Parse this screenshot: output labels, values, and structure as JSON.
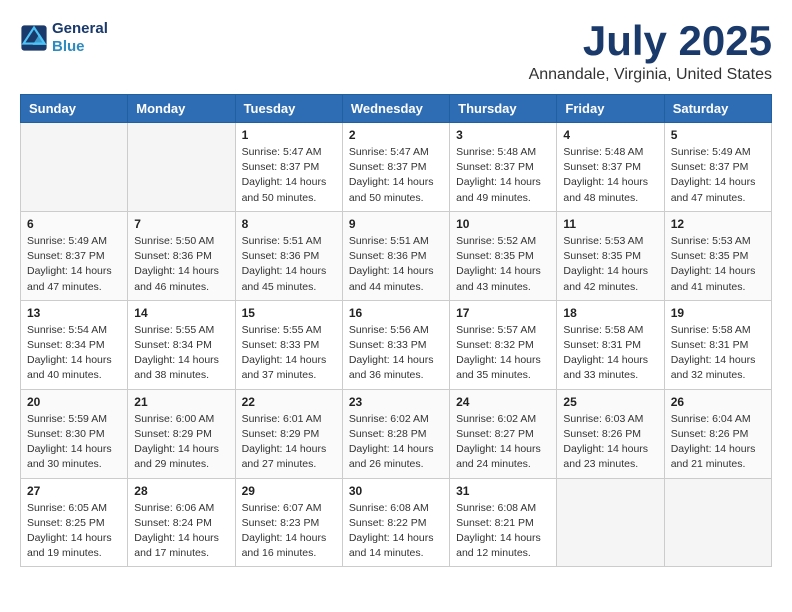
{
  "header": {
    "logo_line1": "General",
    "logo_line2": "Blue",
    "title": "July 2025",
    "subtitle": "Annandale, Virginia, United States"
  },
  "days_of_week": [
    "Sunday",
    "Monday",
    "Tuesday",
    "Wednesday",
    "Thursday",
    "Friday",
    "Saturday"
  ],
  "weeks": [
    [
      {
        "day": "",
        "info": ""
      },
      {
        "day": "",
        "info": ""
      },
      {
        "day": "1",
        "info": "Sunrise: 5:47 AM\nSunset: 8:37 PM\nDaylight: 14 hours and 50 minutes."
      },
      {
        "day": "2",
        "info": "Sunrise: 5:47 AM\nSunset: 8:37 PM\nDaylight: 14 hours and 50 minutes."
      },
      {
        "day": "3",
        "info": "Sunrise: 5:48 AM\nSunset: 8:37 PM\nDaylight: 14 hours and 49 minutes."
      },
      {
        "day": "4",
        "info": "Sunrise: 5:48 AM\nSunset: 8:37 PM\nDaylight: 14 hours and 48 minutes."
      },
      {
        "day": "5",
        "info": "Sunrise: 5:49 AM\nSunset: 8:37 PM\nDaylight: 14 hours and 47 minutes."
      }
    ],
    [
      {
        "day": "6",
        "info": "Sunrise: 5:49 AM\nSunset: 8:37 PM\nDaylight: 14 hours and 47 minutes."
      },
      {
        "day": "7",
        "info": "Sunrise: 5:50 AM\nSunset: 8:36 PM\nDaylight: 14 hours and 46 minutes."
      },
      {
        "day": "8",
        "info": "Sunrise: 5:51 AM\nSunset: 8:36 PM\nDaylight: 14 hours and 45 minutes."
      },
      {
        "day": "9",
        "info": "Sunrise: 5:51 AM\nSunset: 8:36 PM\nDaylight: 14 hours and 44 minutes."
      },
      {
        "day": "10",
        "info": "Sunrise: 5:52 AM\nSunset: 8:35 PM\nDaylight: 14 hours and 43 minutes."
      },
      {
        "day": "11",
        "info": "Sunrise: 5:53 AM\nSunset: 8:35 PM\nDaylight: 14 hours and 42 minutes."
      },
      {
        "day": "12",
        "info": "Sunrise: 5:53 AM\nSunset: 8:35 PM\nDaylight: 14 hours and 41 minutes."
      }
    ],
    [
      {
        "day": "13",
        "info": "Sunrise: 5:54 AM\nSunset: 8:34 PM\nDaylight: 14 hours and 40 minutes."
      },
      {
        "day": "14",
        "info": "Sunrise: 5:55 AM\nSunset: 8:34 PM\nDaylight: 14 hours and 38 minutes."
      },
      {
        "day": "15",
        "info": "Sunrise: 5:55 AM\nSunset: 8:33 PM\nDaylight: 14 hours and 37 minutes."
      },
      {
        "day": "16",
        "info": "Sunrise: 5:56 AM\nSunset: 8:33 PM\nDaylight: 14 hours and 36 minutes."
      },
      {
        "day": "17",
        "info": "Sunrise: 5:57 AM\nSunset: 8:32 PM\nDaylight: 14 hours and 35 minutes."
      },
      {
        "day": "18",
        "info": "Sunrise: 5:58 AM\nSunset: 8:31 PM\nDaylight: 14 hours and 33 minutes."
      },
      {
        "day": "19",
        "info": "Sunrise: 5:58 AM\nSunset: 8:31 PM\nDaylight: 14 hours and 32 minutes."
      }
    ],
    [
      {
        "day": "20",
        "info": "Sunrise: 5:59 AM\nSunset: 8:30 PM\nDaylight: 14 hours and 30 minutes."
      },
      {
        "day": "21",
        "info": "Sunrise: 6:00 AM\nSunset: 8:29 PM\nDaylight: 14 hours and 29 minutes."
      },
      {
        "day": "22",
        "info": "Sunrise: 6:01 AM\nSunset: 8:29 PM\nDaylight: 14 hours and 27 minutes."
      },
      {
        "day": "23",
        "info": "Sunrise: 6:02 AM\nSunset: 8:28 PM\nDaylight: 14 hours and 26 minutes."
      },
      {
        "day": "24",
        "info": "Sunrise: 6:02 AM\nSunset: 8:27 PM\nDaylight: 14 hours and 24 minutes."
      },
      {
        "day": "25",
        "info": "Sunrise: 6:03 AM\nSunset: 8:26 PM\nDaylight: 14 hours and 23 minutes."
      },
      {
        "day": "26",
        "info": "Sunrise: 6:04 AM\nSunset: 8:26 PM\nDaylight: 14 hours and 21 minutes."
      }
    ],
    [
      {
        "day": "27",
        "info": "Sunrise: 6:05 AM\nSunset: 8:25 PM\nDaylight: 14 hours and 19 minutes."
      },
      {
        "day": "28",
        "info": "Sunrise: 6:06 AM\nSunset: 8:24 PM\nDaylight: 14 hours and 17 minutes."
      },
      {
        "day": "29",
        "info": "Sunrise: 6:07 AM\nSunset: 8:23 PM\nDaylight: 14 hours and 16 minutes."
      },
      {
        "day": "30",
        "info": "Sunrise: 6:08 AM\nSunset: 8:22 PM\nDaylight: 14 hours and 14 minutes."
      },
      {
        "day": "31",
        "info": "Sunrise: 6:08 AM\nSunset: 8:21 PM\nDaylight: 14 hours and 12 minutes."
      },
      {
        "day": "",
        "info": ""
      },
      {
        "day": "",
        "info": ""
      }
    ]
  ]
}
